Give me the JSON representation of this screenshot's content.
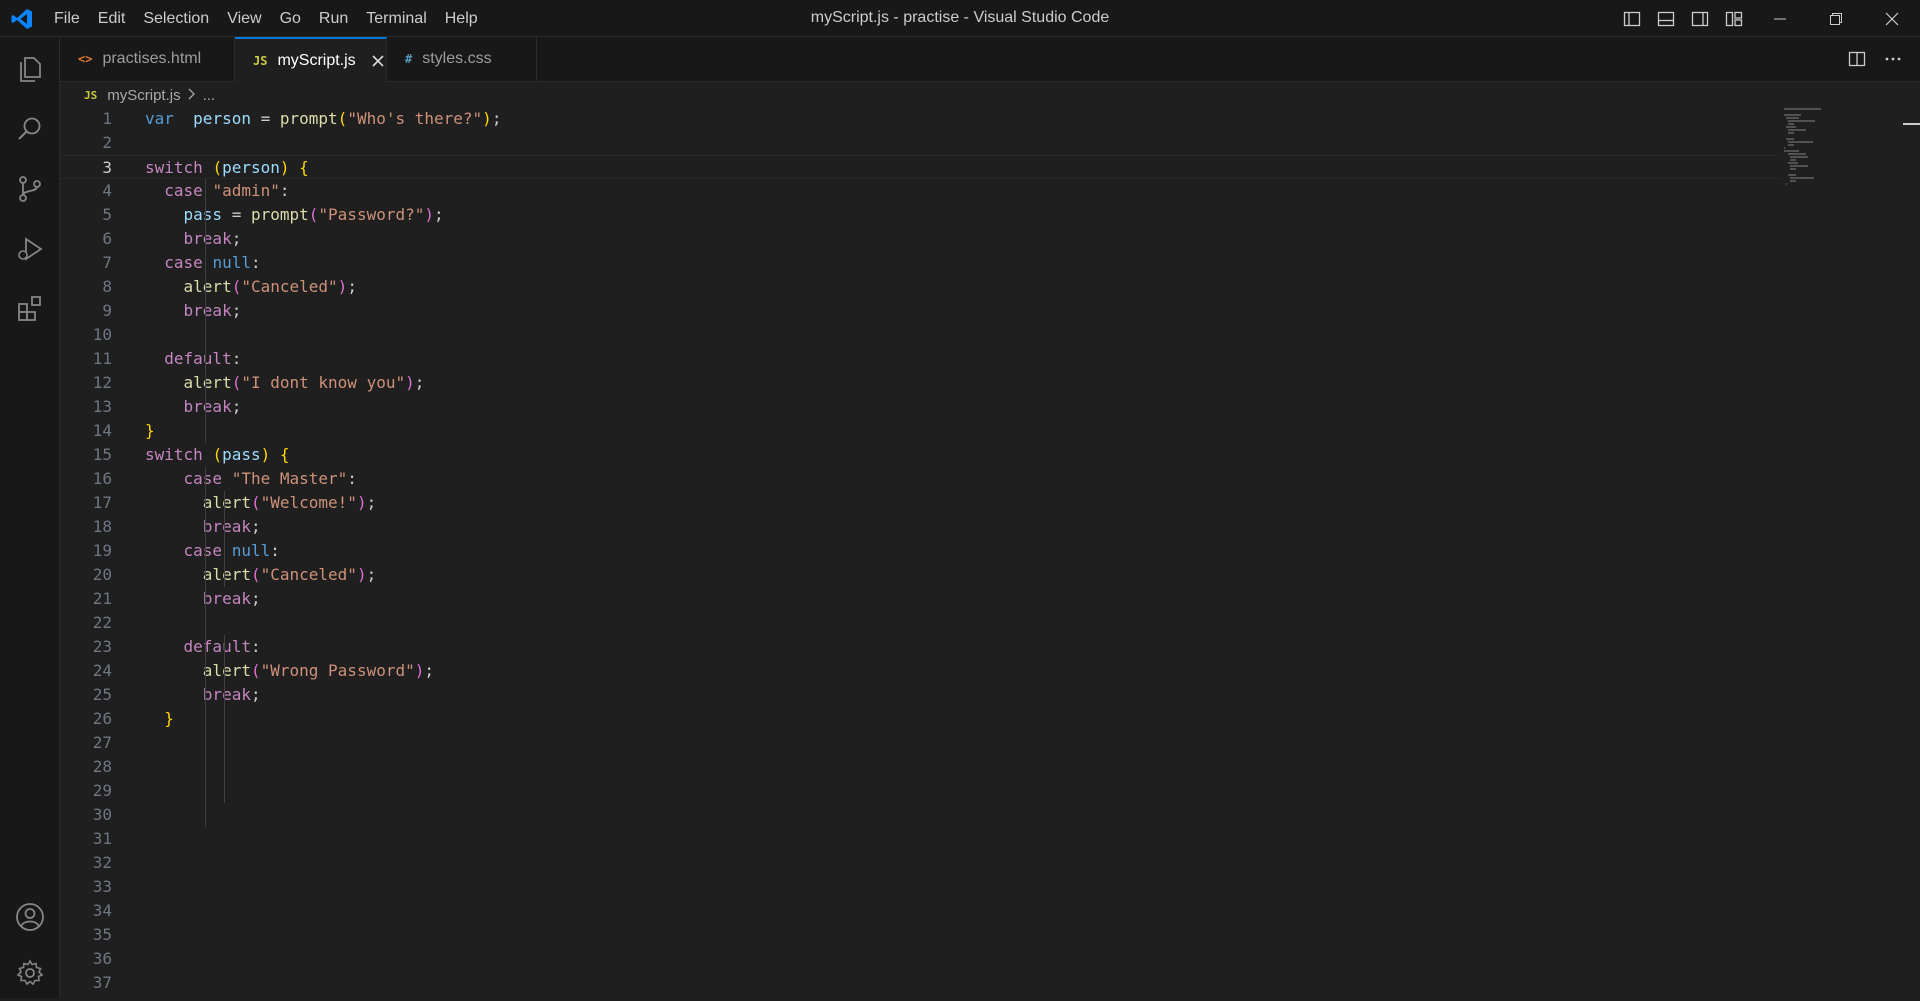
{
  "window": {
    "title": "myScript.js - practise - Visual Studio Code"
  },
  "menu": [
    "File",
    "Edit",
    "Selection",
    "View",
    "Go",
    "Run",
    "Terminal",
    "Help"
  ],
  "activity_bar": [
    "explorer-icon",
    "search-icon",
    "source-control-icon",
    "run-debug-icon",
    "extensions-icon",
    "accounts-icon",
    "manage-gear-icon"
  ],
  "tabs": [
    {
      "label": "practises.html",
      "icon": "<>",
      "icon_color": "#e37933"
    },
    {
      "label": "myScript.js",
      "icon": "JS",
      "icon_color": "#cbcb41",
      "active": true
    },
    {
      "label": "styles.css",
      "icon": "#",
      "icon_color": "#519aba"
    }
  ],
  "breadcrumb": {
    "file": "myScript.js",
    "icon": "JS",
    "rest": "..."
  },
  "editor": {
    "active_line": 3,
    "line_numbers": [
      "1",
      "2",
      "3",
      "4",
      "5",
      "6",
      "7",
      "8",
      "9",
      "10",
      "11",
      "12",
      "13",
      "14",
      "15",
      "16",
      "17",
      "18",
      "19",
      "20",
      "21",
      "22",
      "23",
      "24",
      "25",
      "26",
      "27",
      "28",
      "29",
      "30",
      "31",
      "32",
      "33",
      "34",
      "35",
      "36",
      "37"
    ],
    "lines": [
      [
        [
          "k",
          "var"
        ],
        [
          "",
          "  "
        ],
        [
          "v",
          "person"
        ],
        [
          "",
          " = "
        ],
        [
          "f",
          "prompt"
        ],
        [
          "b",
          "("
        ],
        [
          "s",
          "\"Who's there?\""
        ],
        [
          "b",
          ")"
        ],
        [
          "",
          ";"
        ]
      ],
      [],
      [
        [
          "c",
          "switch"
        ],
        [
          "",
          " "
        ],
        [
          "b",
          "("
        ],
        [
          "v",
          "person"
        ],
        [
          "b",
          ")"
        ],
        [
          "",
          " "
        ],
        [
          "b",
          "{"
        ]
      ],
      [
        [
          "",
          "  "
        ],
        [
          "c",
          "case"
        ],
        [
          "",
          " "
        ],
        [
          "s",
          "\"admin\""
        ],
        [
          "",
          ":"
        ]
      ],
      [
        [
          "",
          "    "
        ],
        [
          "v",
          "pass"
        ],
        [
          "",
          " = "
        ],
        [
          "f",
          "prompt"
        ],
        [
          "p",
          "("
        ],
        [
          "s",
          "\"Password?\""
        ],
        [
          "p",
          ")"
        ],
        [
          "",
          ";"
        ]
      ],
      [
        [
          "",
          "    "
        ],
        [
          "c",
          "break"
        ],
        [
          "",
          ";"
        ]
      ],
      [
        [
          "",
          "  "
        ],
        [
          "c",
          "case"
        ],
        [
          "",
          " "
        ],
        [
          "k",
          "null"
        ],
        [
          "",
          ":"
        ]
      ],
      [
        [
          "",
          "    "
        ],
        [
          "f",
          "alert"
        ],
        [
          "p",
          "("
        ],
        [
          "s",
          "\"Canceled\""
        ],
        [
          "p",
          ")"
        ],
        [
          "",
          ";"
        ]
      ],
      [
        [
          "",
          "    "
        ],
        [
          "c",
          "break"
        ],
        [
          "",
          ";"
        ]
      ],
      [],
      [
        [
          "",
          "  "
        ],
        [
          "c",
          "default"
        ],
        [
          "",
          ":"
        ]
      ],
      [
        [
          "",
          "    "
        ],
        [
          "f",
          "alert"
        ],
        [
          "p",
          "("
        ],
        [
          "s",
          "\"I dont know you\""
        ],
        [
          "p",
          ")"
        ],
        [
          "",
          ";"
        ]
      ],
      [
        [
          "",
          "    "
        ],
        [
          "c",
          "break"
        ],
        [
          "",
          ";"
        ]
      ],
      [
        [
          "b",
          "}"
        ]
      ],
      [
        [
          "c",
          "switch"
        ],
        [
          "",
          " "
        ],
        [
          "b",
          "("
        ],
        [
          "v",
          "pass"
        ],
        [
          "b",
          ")"
        ],
        [
          "",
          " "
        ],
        [
          "b",
          "{"
        ]
      ],
      [
        [
          "",
          "    "
        ],
        [
          "c",
          "case"
        ],
        [
          "",
          " "
        ],
        [
          "s",
          "\"The Master\""
        ],
        [
          "",
          ":"
        ]
      ],
      [
        [
          "",
          "      "
        ],
        [
          "f",
          "alert"
        ],
        [
          "p",
          "("
        ],
        [
          "s",
          "\"Welcome!\""
        ],
        [
          "p",
          ")"
        ],
        [
          "",
          ";"
        ]
      ],
      [
        [
          "",
          "      "
        ],
        [
          "c",
          "break"
        ],
        [
          "",
          ";"
        ]
      ],
      [
        [
          "",
          "    "
        ],
        [
          "c",
          "case"
        ],
        [
          "",
          " "
        ],
        [
          "k",
          "null"
        ],
        [
          "",
          ":"
        ]
      ],
      [
        [
          "",
          "      "
        ],
        [
          "f",
          "alert"
        ],
        [
          "p",
          "("
        ],
        [
          "s",
          "\"Canceled\""
        ],
        [
          "p",
          ")"
        ],
        [
          "",
          ";"
        ]
      ],
      [
        [
          "",
          "      "
        ],
        [
          "c",
          "break"
        ],
        [
          "",
          ";"
        ]
      ],
      [],
      [
        [
          "",
          "    "
        ],
        [
          "c",
          "default"
        ],
        [
          "",
          ":"
        ]
      ],
      [
        [
          "",
          "      "
        ],
        [
          "f",
          "alert"
        ],
        [
          "p",
          "("
        ],
        [
          "s",
          "\"Wrong Password\""
        ],
        [
          "p",
          ")"
        ],
        [
          "",
          ";"
        ]
      ],
      [
        [
          "",
          "      "
        ],
        [
          "c",
          "break"
        ],
        [
          "",
          ";"
        ]
      ],
      [
        [
          "",
          "  "
        ],
        [
          "b",
          "}"
        ]
      ],
      [],
      [],
      [],
      [],
      [],
      [],
      [],
      [],
      [],
      [],
      []
    ]
  }
}
